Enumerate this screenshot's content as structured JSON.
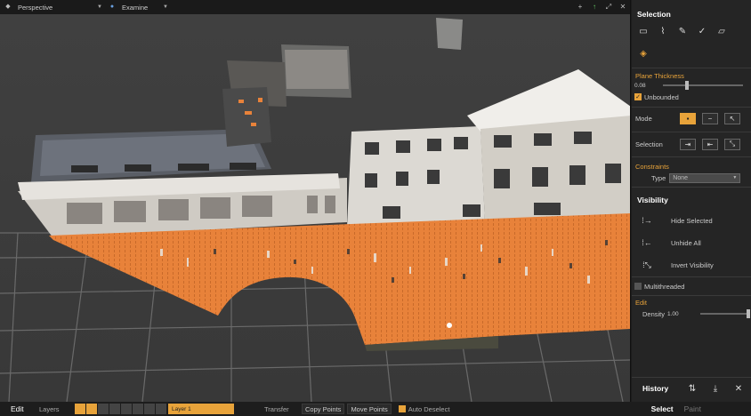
{
  "viewport": {
    "view_dropdown": "Perspective",
    "mode_dropdown": "Examine",
    "toolbar_icons": [
      "plus-icon",
      "up-arrow-icon",
      "expand-icon",
      "close-icon"
    ]
  },
  "panel": {
    "selection_title": "Selection",
    "selection_tools": [
      "rectangle-select-icon",
      "polygon-select-icon",
      "brush-select-icon",
      "magic-select-icon",
      "plane-select-icon",
      "fill-select-icon"
    ],
    "plane_thickness_label": "Plane Thickness",
    "plane_thickness_value": "0.08",
    "plane_thickness_fraction": 0.3,
    "unbounded_label": "Unbounded",
    "unbounded_checked": true,
    "mode_label": "Mode",
    "selection_label": "Selection",
    "constraints_label": "Constraints",
    "type_label": "Type",
    "type_value": "None",
    "visibility_title": "Visibility",
    "hide_selected": "Hide Selected",
    "unhide_all": "Unhide All",
    "invert_visibility": "Invert Visibility",
    "multithreaded_label": "Multithreaded",
    "multithreaded_checked": false,
    "edit_label": "Edit",
    "density_label": "Density",
    "density_value": "1.00",
    "density_fraction": 1.0,
    "history_label": "History"
  },
  "bottombar": {
    "edit": "Edit",
    "layers": "Layers",
    "layer_name": "Layer 1",
    "transfer": "Transfer",
    "copy_points": "Copy Points",
    "move_points": "Move Points",
    "auto_deselect": "Auto Deselect",
    "auto_deselect_checked": true,
    "select": "Select",
    "paint": "Paint"
  },
  "colors": {
    "accent": "#e8a33a",
    "selection_orange": "#e8823a",
    "panel_bg": "#252525",
    "viewport_bg": "#3a3a3a"
  }
}
